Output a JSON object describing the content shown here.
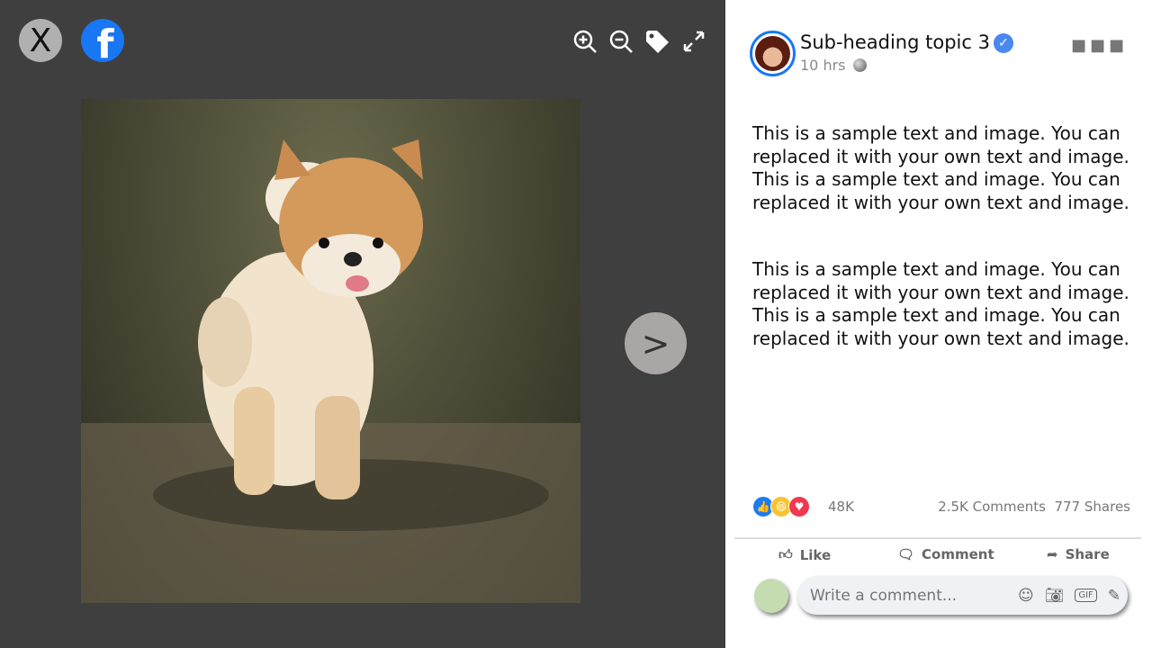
{
  "viewer": {
    "close_label": "X",
    "facebook_label": "f",
    "next_label": ">"
  },
  "post": {
    "author": "Sub-heading topic 3",
    "time": "10 hrs",
    "paragraphs": [
      "This is a sample text and image. You can replaced it with your own text and image. This is a sample text and image. You can replaced it with your own text and image.",
      "This is a sample text and image. You can replaced it with your own text and image. This is a sample text and image. You can replaced it with your own text and image."
    ],
    "reactions_count": "48K",
    "comments": "2.5K Comments",
    "shares": "777 Shares",
    "actions": {
      "like": "Like",
      "comment": "Comment",
      "share": "Share"
    },
    "comment_placeholder": "Write a comment..."
  }
}
